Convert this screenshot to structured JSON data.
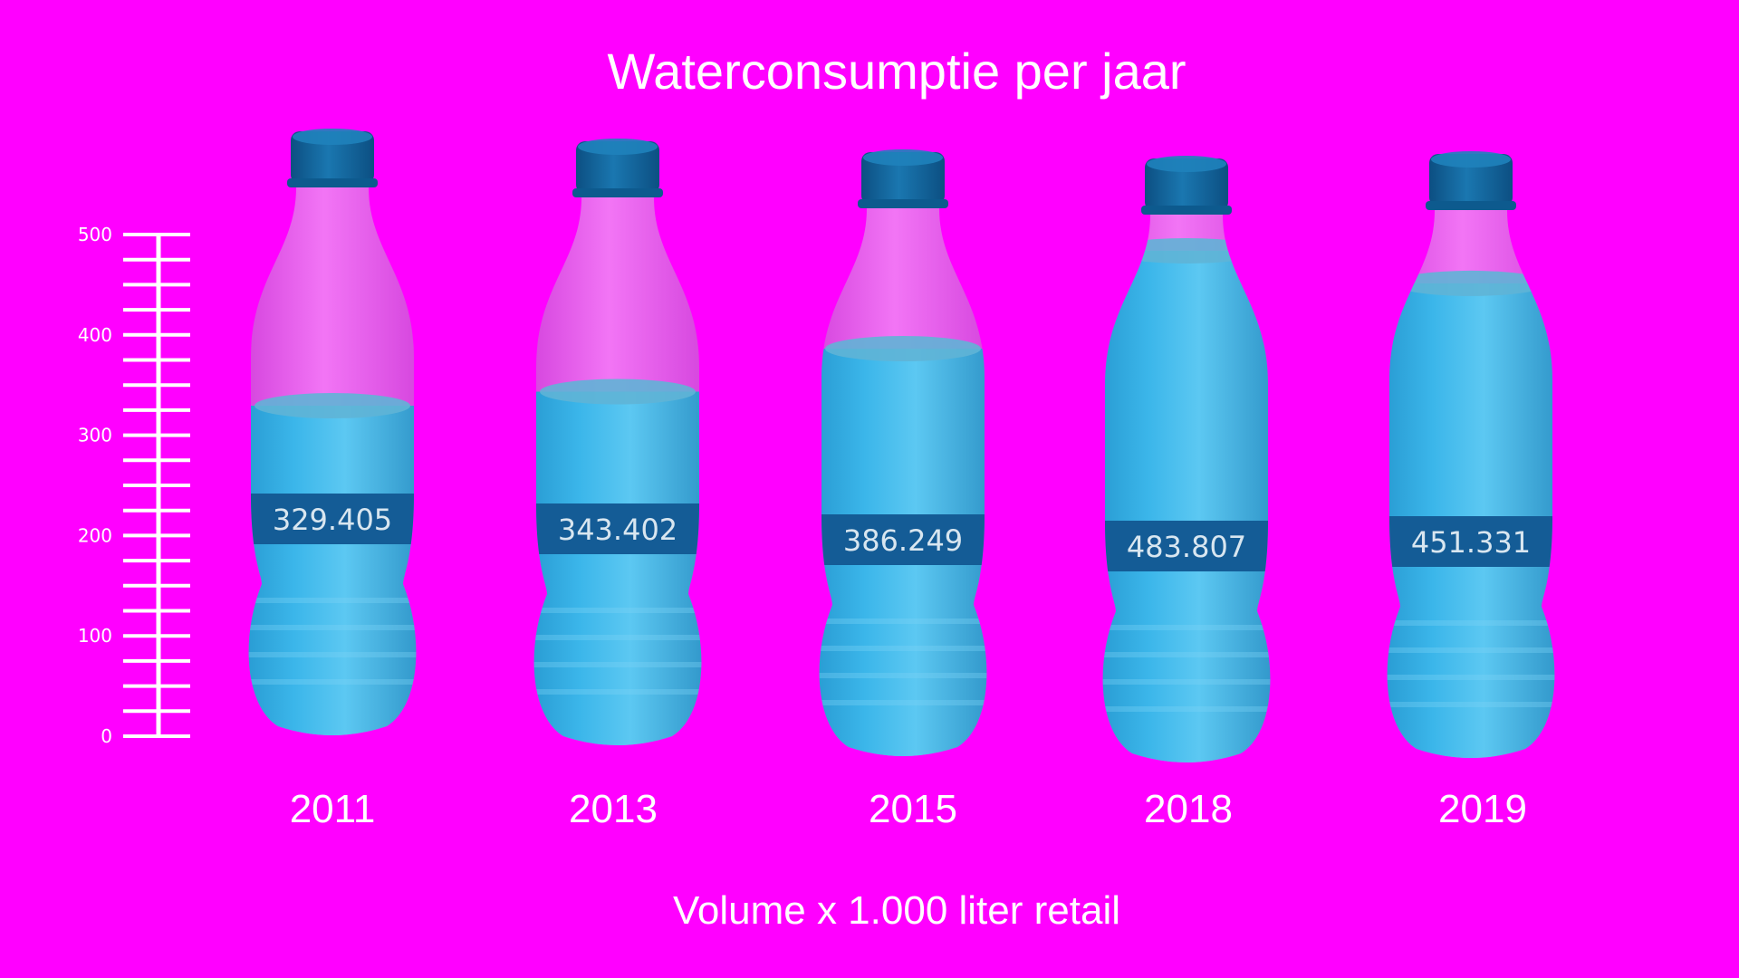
{
  "chart_data": {
    "type": "bar",
    "title": "Waterconsumptie per jaar",
    "xlabel": "Volume x 1.000 liter retail",
    "ylabel": "",
    "categories": [
      "2011",
      "2013",
      "2015",
      "2018",
      "2019"
    ],
    "values": [
      329405,
      343402,
      386249,
      483807,
      451331
    ],
    "value_labels": [
      "329.405",
      "343.402",
      "386.249",
      "483.807",
      "451.331"
    ],
    "ylim": [
      0,
      500
    ],
    "yticks": [
      "0",
      "100",
      "200",
      "300",
      "400",
      "500"
    ],
    "unit_scale": 1000,
    "grid": false,
    "legend": "none",
    "colors": {
      "background": "#ff00ff",
      "water": "#2a9fd6",
      "water_dark": "#1c7fb3",
      "cap": "#0f5f96",
      "label_band": "#145c96",
      "bottle_empty": "#e07ee6",
      "text": "#ffffff"
    }
  }
}
